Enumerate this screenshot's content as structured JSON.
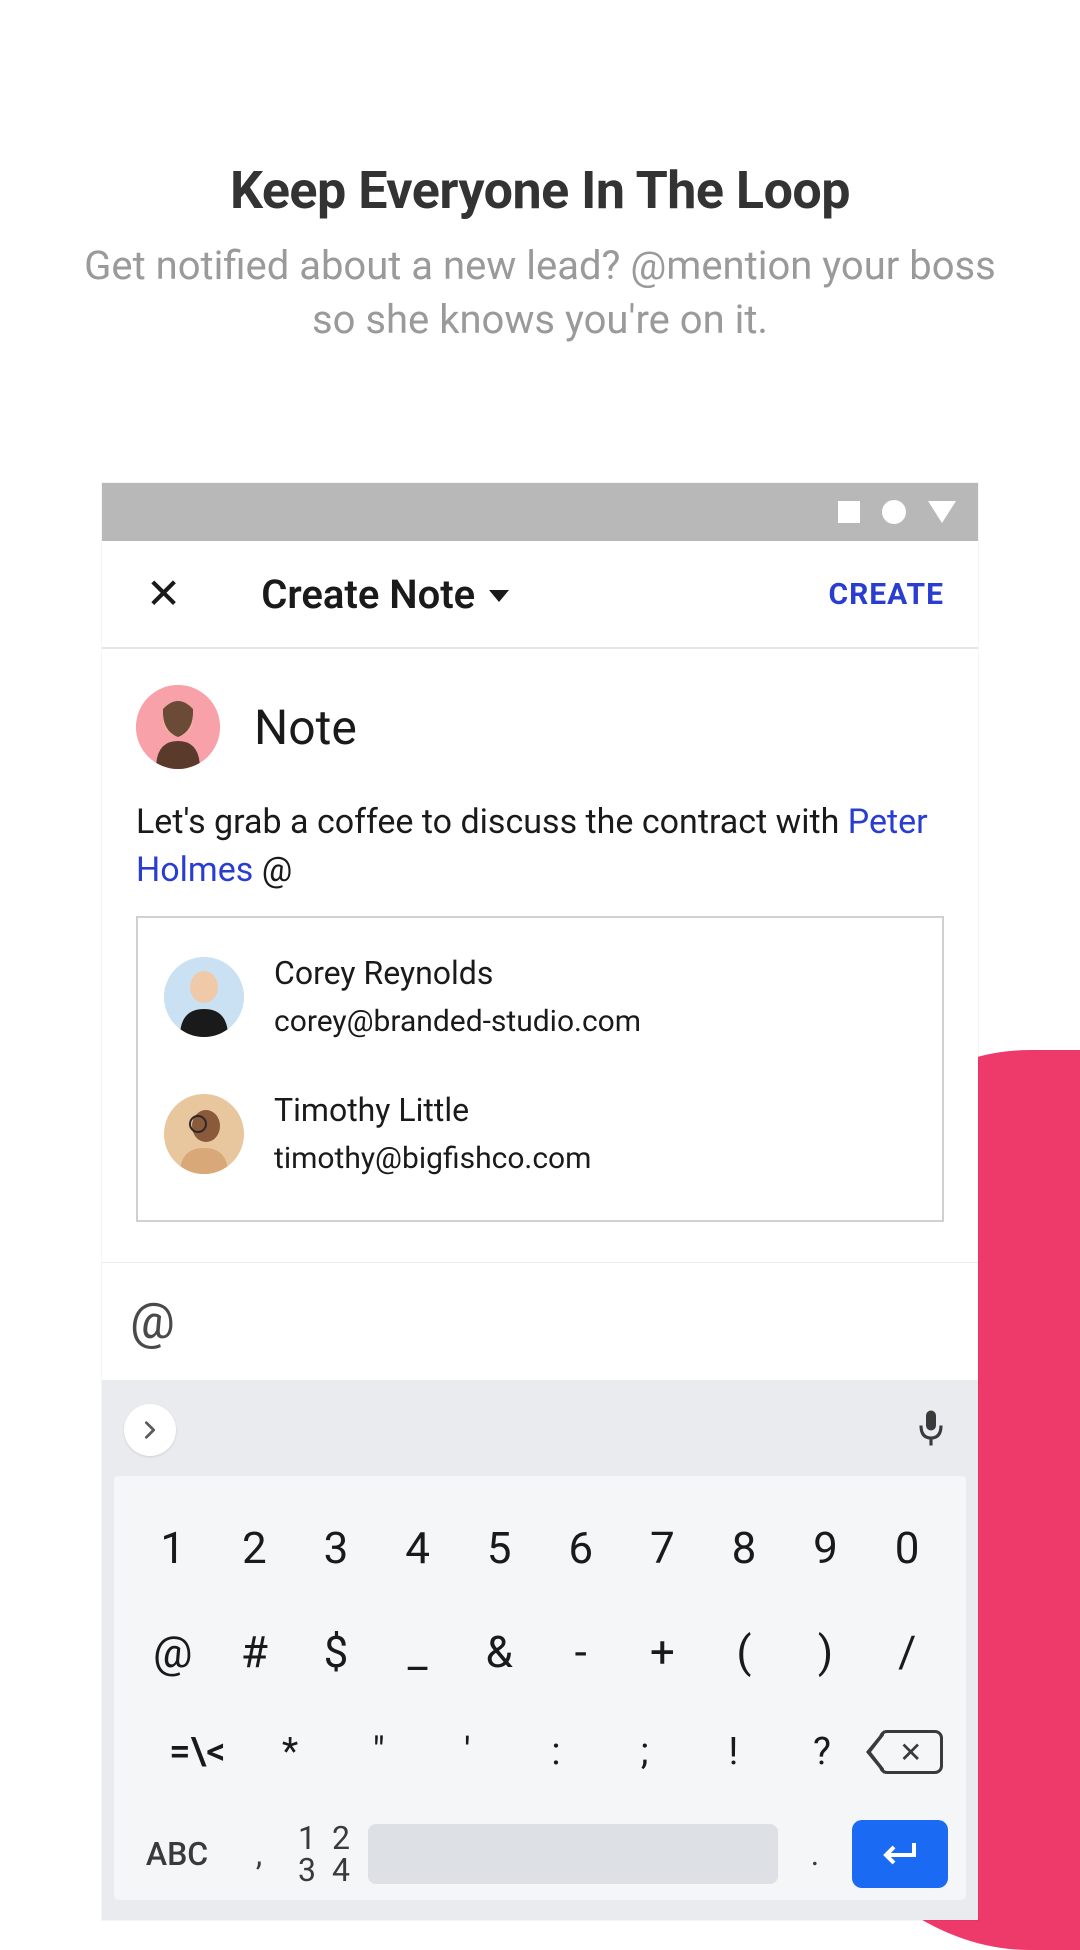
{
  "marketing": {
    "title": "Keep Everyone In The Loop",
    "subtitle": "Get notified about a new lead? @mention your boss so she knows you're on it."
  },
  "header": {
    "title": "Create Note",
    "action": "CREATE"
  },
  "note": {
    "type_label": "Note",
    "body_prefix": "Let's grab a coffee to discuss the contract with ",
    "mention": "Peter Holmes",
    "body_suffix": " @"
  },
  "suggestions": [
    {
      "name": "Corey Reynolds",
      "email": "corey@branded-studio.com"
    },
    {
      "name": "Timothy Little",
      "email": "timothy@bigfishco.com"
    }
  ],
  "input_bar": {
    "value": "@"
  },
  "keyboard": {
    "row1": [
      "1",
      "2",
      "3",
      "4",
      "5",
      "6",
      "7",
      "8",
      "9",
      "0"
    ],
    "row2": [
      "@",
      "#",
      "$",
      "_",
      "&",
      "-",
      "+",
      "(",
      ")",
      "/"
    ],
    "row3_mode": "=\\<",
    "row3": [
      "*",
      "\"",
      "'",
      ":",
      ";",
      "!",
      "?"
    ],
    "abc": "ABC",
    "nums_top": "1 2",
    "nums_bot": "3 4",
    "comma": ",",
    "dot": "."
  },
  "colors": {
    "accent_blue": "#2a3dd1",
    "enter_blue": "#1a6af4",
    "pink": "#ee3a6a"
  }
}
